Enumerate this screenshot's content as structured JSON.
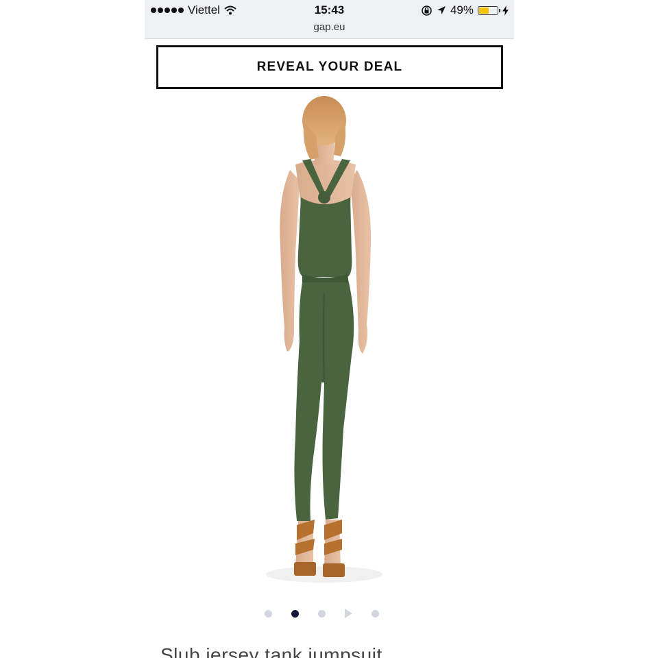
{
  "status_bar": {
    "carrier": "Viettel",
    "time": "15:43",
    "battery_percent": "49%",
    "battery_level": 0.49,
    "battery_color": "#f5c20a",
    "icons": [
      "signal-dots-icon",
      "wifi-icon",
      "orientation-lock-icon",
      "location-arrow-icon",
      "battery-icon",
      "charging-bolt-icon"
    ]
  },
  "browser": {
    "url": "gap.eu"
  },
  "promo": {
    "button_label": "REVEAL YOUR DEAL"
  },
  "product": {
    "image_alt_description": "",
    "garment_color": "#4a6440",
    "carousel": {
      "count": 5,
      "active_index": 1,
      "video_index": 3
    },
    "title": "Slub jersey tank jumpsuit"
  }
}
